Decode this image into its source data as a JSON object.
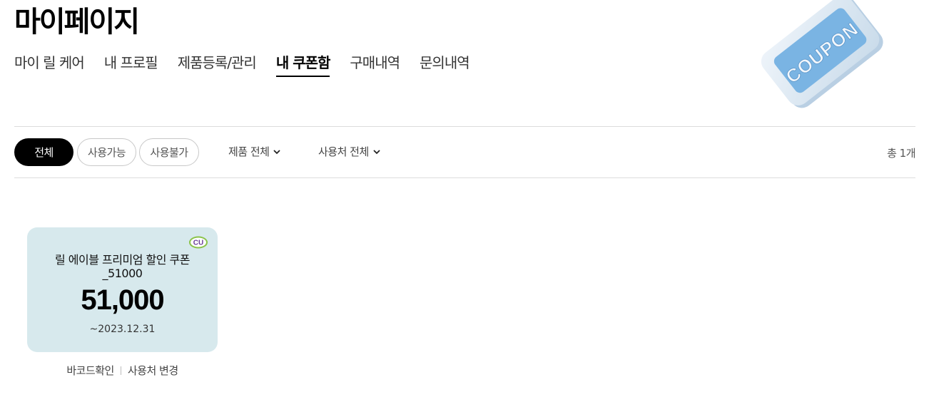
{
  "header": {
    "title": "마이페이지"
  },
  "tabs": [
    {
      "label": "마이 릴 케어"
    },
    {
      "label": "내 프로필"
    },
    {
      "label": "제품등록/관리"
    },
    {
      "label": "내 쿠폰함"
    },
    {
      "label": "구매내역"
    },
    {
      "label": "문의내역"
    }
  ],
  "active_tab": "내 쿠폰함",
  "badge": {
    "text": "COUPON",
    "color": "#7ab4e3"
  },
  "filters": {
    "all": "전체",
    "usable": "사용가능",
    "unusable": "사용불가",
    "product_dropdown": "제품 전체",
    "place_dropdown": "사용처 전체",
    "total": "총 1개"
  },
  "coupons": [
    {
      "name": "릴 에이블 프리미엄 할인 쿠폰 _51000",
      "amount": "51,000",
      "expiry": "~2023.12.31",
      "brand_logo": "CU",
      "card_color": "#d7e9ed",
      "actions": {
        "barcode": "바코드확인",
        "change_place": "사용처 변경"
      }
    }
  ],
  "icons": {
    "chevron": "chevron-down-icon",
    "brand": "cu-logo-icon",
    "badge": "coupon-tag-icon"
  }
}
